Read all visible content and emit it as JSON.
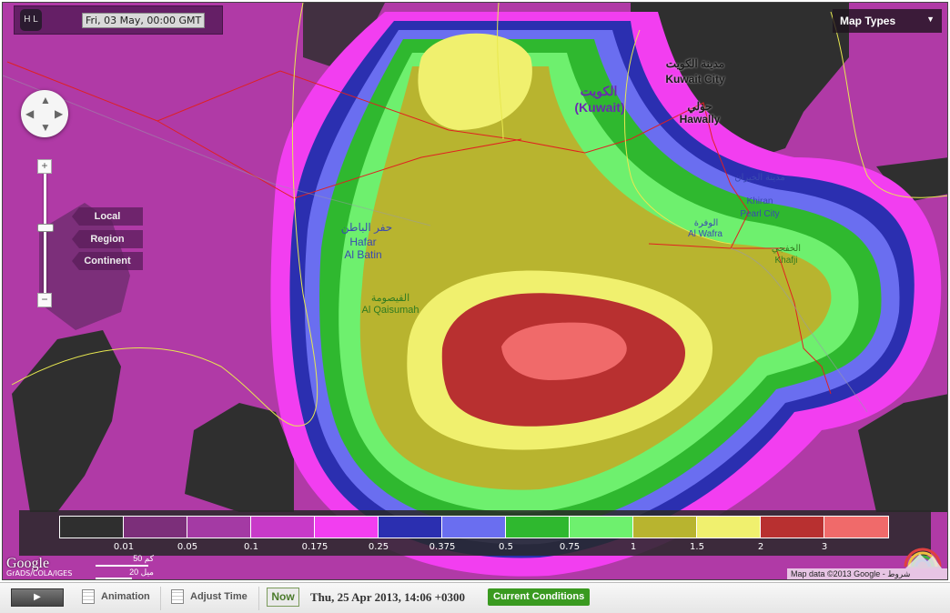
{
  "top_bar": {
    "logo_text": "H L",
    "time_display": "Fri, 03 May, 00:00 GMT",
    "map_types_label": "Map Types"
  },
  "scope_buttons": [
    {
      "label": "Local"
    },
    {
      "label": "Region"
    },
    {
      "label": "Continent"
    }
  ],
  "zoom": {
    "in_label": "+",
    "out_label": "−"
  },
  "places": {
    "kuwait_city_ar": "مدينة الكويت",
    "kuwait_city": "Kuwait City",
    "kuwait_ar": "الكويت",
    "kuwait": "(Kuwait)",
    "hawally_ar": "حولي",
    "hawally": "Hawally",
    "hafar_ar": "حفر الباطن",
    "hafar": "Hafar\nAl Batin",
    "qaisumah_ar": "القيصومة",
    "qaisumah": "Al Qaisumah",
    "wafra_ar": "الوفرة",
    "wafra": "Al Wafra",
    "khiran_ar": "مدينة الخيران",
    "khiran": "Khiran\nPearl City",
    "khafji_ar": "الخفجي",
    "khafji": "Khafji"
  },
  "legend": {
    "colors": [
      "#2f2f2f",
      "#7c2f7a",
      "#a43aa4",
      "#c83ac8",
      "#f23ef0",
      "#2b2fb0",
      "#6a6ef0",
      "#2fb82f",
      "#6ef06e",
      "#b8b42f",
      "#f0f06e",
      "#b83030",
      "#f06a6a"
    ],
    "labels": [
      "0.01",
      "0.05",
      "0.1",
      "0.175",
      "0.25",
      "0.375",
      "0.5",
      "0.75",
      "1",
      "1.5",
      "2",
      "3"
    ]
  },
  "credits": {
    "google": "Google",
    "grads": "GrADS/COLA/IGES",
    "scale_km": "50 كم",
    "scale_mi": "20 ميل",
    "map_data": "Map data ©2013 Google - شروط الاستخدام"
  },
  "bottom_bar": {
    "play_label": "▶",
    "animation_label": "Animation",
    "adjust_time_label": "Adjust Time",
    "now_label": "Now",
    "current_time": "Thu, 25 Apr 2013, 14:06 +0300",
    "current_conditions_label": "Current Conditions"
  }
}
